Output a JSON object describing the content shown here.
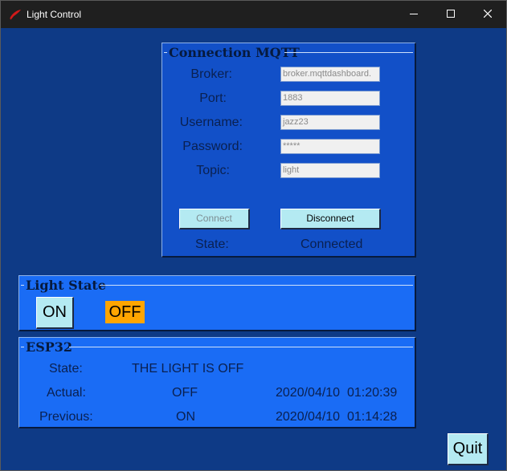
{
  "window": {
    "title": "Light Control"
  },
  "mqtt": {
    "legend": "Connection MQTT",
    "broker_label": "Broker:",
    "port_label": "Port:",
    "username_label": "Username:",
    "password_label": "Password:",
    "topic_label": "Topic:",
    "broker_value": "broker.mqttdashboard.",
    "port_value": "1883",
    "username_value": "jazz23",
    "password_value": "*****",
    "topic_value": "light",
    "connect_label": "Connect",
    "disconnect_label": "Disconnect",
    "state_label": "State:",
    "state_value": "Connected"
  },
  "light_state": {
    "legend": "Light State",
    "on_label": "ON",
    "off_label": "OFF",
    "off_color": "#ffa500"
  },
  "esp32": {
    "legend": "ESP32",
    "state_label": "State:",
    "state_value": "THE LIGHT IS OFF",
    "actual_label": "Actual:",
    "actual_value": "OFF",
    "actual_date": "2020/04/10",
    "actual_time": "01:20:39",
    "previous_label": "Previous:",
    "previous_value": "ON",
    "previous_date": "2020/04/10",
    "previous_time": "01:14:28"
  },
  "quit_label": "Quit",
  "colors": {
    "background": "#0e3a86",
    "panel": "#1a6cf5",
    "button": "#b4eaf2"
  }
}
